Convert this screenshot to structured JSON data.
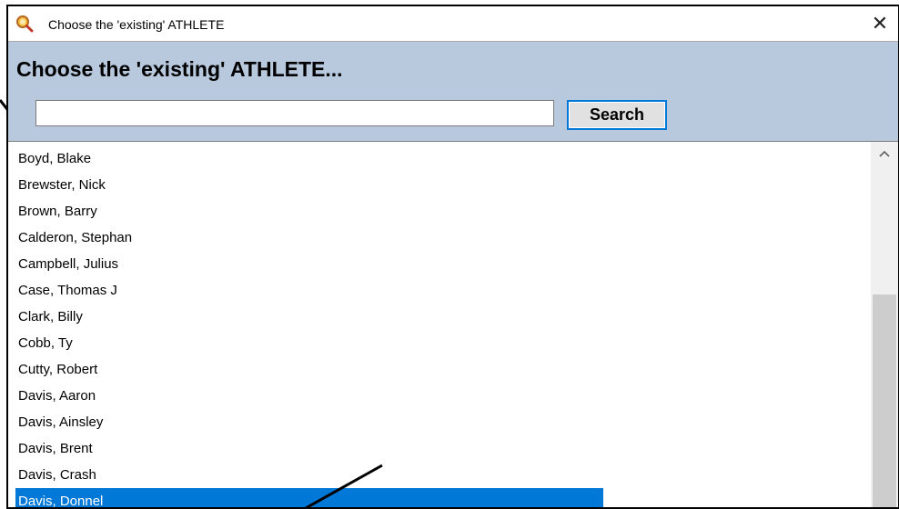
{
  "window": {
    "title": "Choose the 'existing' ATHLETE",
    "close_symbol": "✕"
  },
  "header": {
    "title": "Choose the 'existing' ATHLETE..."
  },
  "search": {
    "value": "",
    "button_label": "Search"
  },
  "athletes": [
    {
      "name": "Boyd, Blake",
      "selected": false
    },
    {
      "name": "Brewster, Nick",
      "selected": false
    },
    {
      "name": "Brown, Barry",
      "selected": false
    },
    {
      "name": "Calderon, Stephan",
      "selected": false
    },
    {
      "name": "Campbell, Julius",
      "selected": false
    },
    {
      "name": "Case, Thomas J",
      "selected": false
    },
    {
      "name": "Clark, Billy",
      "selected": false
    },
    {
      "name": "Cobb, Ty",
      "selected": false
    },
    {
      "name": "Cutty, Robert",
      "selected": false
    },
    {
      "name": "Davis, Aaron",
      "selected": false
    },
    {
      "name": "Davis, Ainsley",
      "selected": false
    },
    {
      "name": "Davis, Brent",
      "selected": false
    },
    {
      "name": "Davis, Crash",
      "selected": false
    },
    {
      "name": "Davis, Donnel",
      "selected": true
    }
  ],
  "icons": {
    "app": "magnifier-icon",
    "close": "close-icon",
    "scroll_up": "chevron-up-icon"
  },
  "colors": {
    "header_bg": "#b8c9de",
    "selection": "#0078d7",
    "button_border": "#0078d7"
  }
}
